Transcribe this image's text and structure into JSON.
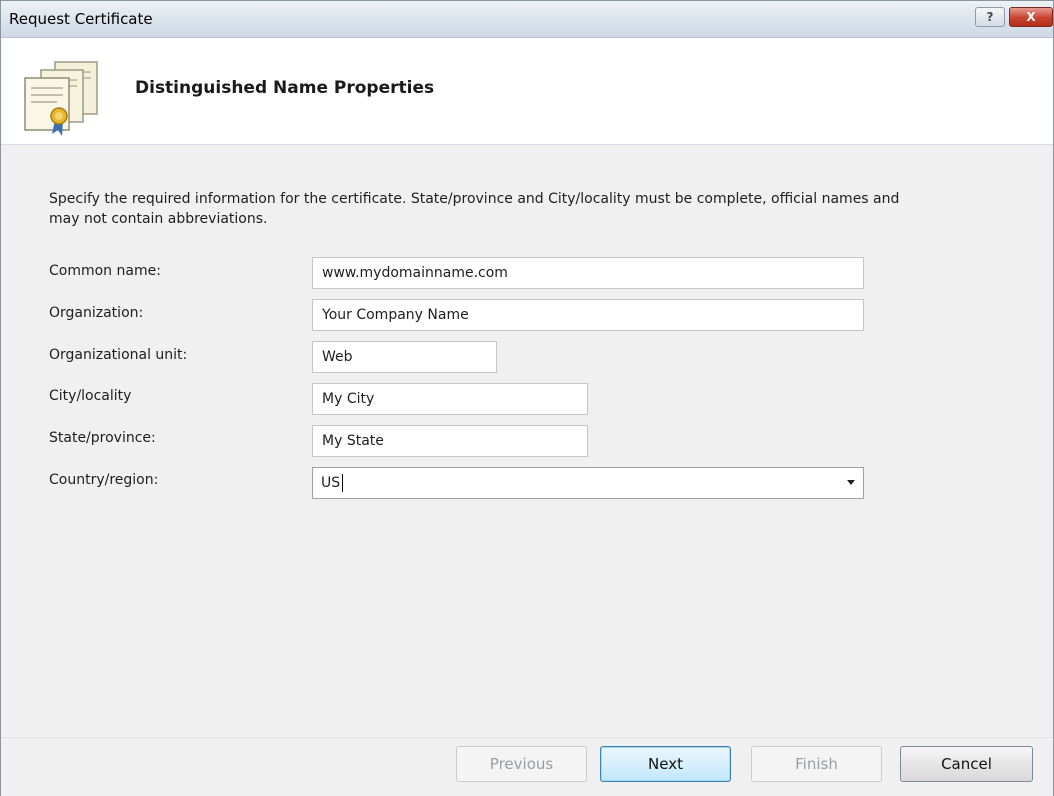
{
  "window": {
    "title": "Request Certificate",
    "help_label": "?",
    "close_label": "X"
  },
  "header": {
    "title": "Distinguished Name Properties",
    "icon": "certificate-icon"
  },
  "instructions": "Specify the required information for the certificate. State/province and City/locality must be complete, official names and may not contain abbreviations.",
  "fields": {
    "common_name": {
      "label": "Common name:",
      "value": "www.mydomainname.com"
    },
    "organization": {
      "label": "Organization:",
      "value": "Your Company Name"
    },
    "organizational_unit": {
      "label": "Organizational unit:",
      "value": "Web"
    },
    "city": {
      "label": "City/locality",
      "value": "My City"
    },
    "state": {
      "label": "State/province:",
      "value": "My State"
    },
    "country": {
      "label": "Country/region:",
      "value": "US"
    }
  },
  "buttons": {
    "previous": {
      "label": "Previous",
      "enabled": false
    },
    "next": {
      "label": "Next",
      "enabled": true
    },
    "finish": {
      "label": "Finish",
      "enabled": false
    },
    "cancel": {
      "label": "Cancel",
      "enabled": true
    }
  }
}
